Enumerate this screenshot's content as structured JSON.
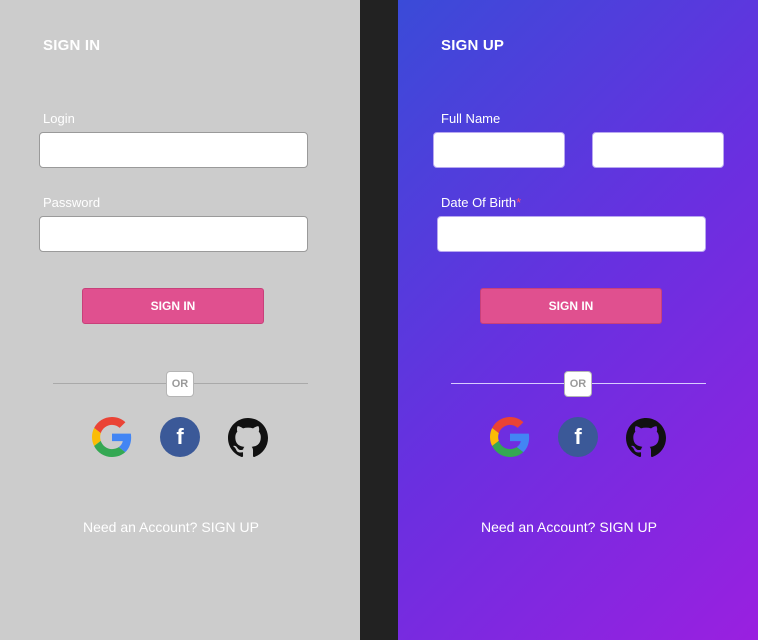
{
  "sign_in": {
    "title": "SIGN IN",
    "login_label": "Login",
    "password_label": "Password",
    "submit_label": "SIGN IN",
    "or_label": "OR",
    "footer_text": "Need an Account?",
    "footer_link": "SIGN UP"
  },
  "sign_up": {
    "title": "SIGN UP",
    "full_name_label": "Full Name",
    "dob_label": "Date Of Birth",
    "required_marker": "*",
    "submit_label": "SIGN IN",
    "or_label": "OR",
    "footer_text": "Need an Account?",
    "footer_link": "SIGN UP"
  },
  "icons": {
    "google": "google-icon",
    "facebook": "facebook-icon",
    "github": "github-icon",
    "facebook_glyph": "f"
  },
  "colors": {
    "left_bg": "#cccccc",
    "gradient_start": "#3a4bd8",
    "gradient_end": "#9a20e0",
    "button": "#e0508f",
    "facebook": "#3b5998",
    "required": "#ff4b6e"
  }
}
